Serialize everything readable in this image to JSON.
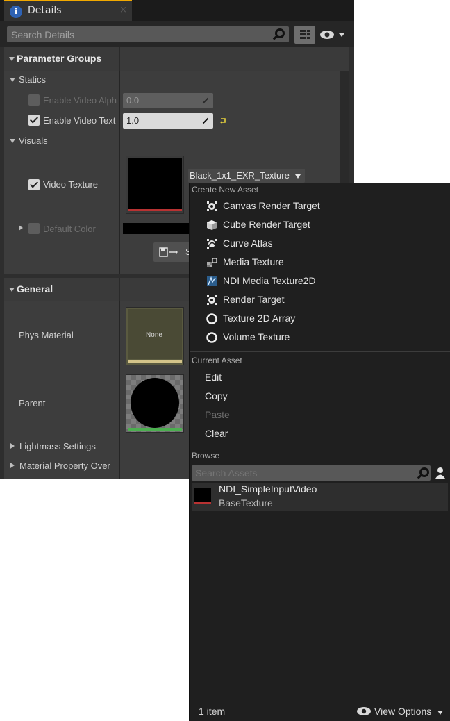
{
  "details": {
    "tab_title": "Details",
    "tab_close": "×",
    "search_placeholder": "Search Details",
    "parameter_groups_label": "Parameter Groups",
    "statics": {
      "label": "Statics",
      "enable_video_alpha": {
        "label": "Enable Video Alph",
        "value": "0.0",
        "checked": false,
        "enabled": false
      },
      "enable_video_texture": {
        "label": "Enable Video Text",
        "value": "1.0",
        "checked": true,
        "enabled": true
      }
    },
    "visuals": {
      "label": "Visuals",
      "video_texture": {
        "label": "Video Texture",
        "checked": true,
        "asset_combo": "Black_1x1_EXR_Texture"
      },
      "default_color": {
        "label": "Default Color",
        "checked": false
      },
      "save_button_text": "S"
    },
    "general": {
      "label": "General",
      "phys_material": {
        "label": "Phys Material",
        "thumb_text": "None"
      },
      "parent": {
        "label": "Parent"
      },
      "lightmass_settings": "Lightmass Settings",
      "material_property_overrides": "Material Property Over"
    }
  },
  "dropdown": {
    "create_new_asset_header": "Create New Asset",
    "create_items": [
      {
        "label": "Canvas Render Target",
        "icon": "canvas-render-target-icon"
      },
      {
        "label": "Cube Render Target",
        "icon": "cube-render-target-icon"
      },
      {
        "label": "Curve Atlas",
        "icon": "curve-atlas-icon"
      },
      {
        "label": "Media Texture",
        "icon": "media-texture-icon"
      },
      {
        "label": "NDI Media Texture2D",
        "icon": "ndi-media-texture-icon"
      },
      {
        "label": "Render Target",
        "icon": "render-target-icon"
      },
      {
        "label": "Texture 2D Array",
        "icon": "texture-2d-array-icon"
      },
      {
        "label": "Volume Texture",
        "icon": "volume-texture-icon"
      }
    ],
    "current_asset_header": "Current Asset",
    "current_items": [
      {
        "label": "Edit",
        "enabled": true
      },
      {
        "label": "Copy",
        "enabled": true
      },
      {
        "label": "Paste",
        "enabled": false
      },
      {
        "label": "Clear",
        "enabled": true
      }
    ],
    "browse_header": "Browse",
    "search_placeholder": "Search Assets",
    "assets": [
      {
        "name": "NDI_SimpleInputVideo",
        "type": "BaseTexture"
      }
    ],
    "item_count": "1 item",
    "view_options": "View Options"
  },
  "colors": {
    "accent_tab": "#f2a900",
    "reset_arrow": "#e6d23c",
    "texture_bar": "#b83232",
    "phys_bar": "#d4c48a",
    "parent_bar": "#4caf50"
  }
}
